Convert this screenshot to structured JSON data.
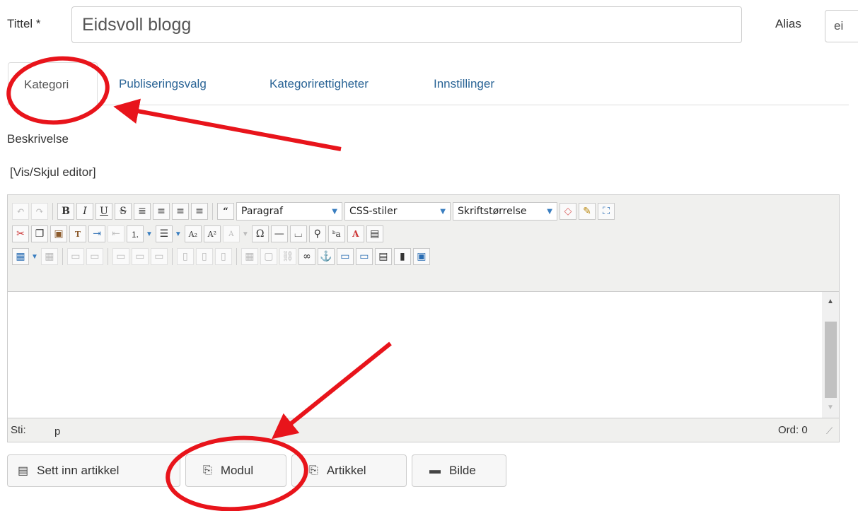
{
  "form": {
    "title_label": "Tittel *",
    "title_value": "Eidsvoll blogg",
    "alias_label": "Alias",
    "alias_value": "ei"
  },
  "tabs": [
    {
      "label": "Kategori",
      "active": true
    },
    {
      "label": "Publiseringsvalg"
    },
    {
      "label": "Kategorirettigheter"
    },
    {
      "label": "Innstillinger"
    }
  ],
  "description_label": "Beskrivelse",
  "toggle_editor": "[Vis/Skjul editor]",
  "editor": {
    "format_select": "Paragraf",
    "styles_select": "CSS-stiler",
    "fontsize_select": "Skriftstørrelse",
    "path_label": "Sti:",
    "path_value": "p",
    "word_count": "Ord: 0"
  },
  "buttons": {
    "insert_article": "Sett inn artikkel",
    "module": "Modul",
    "article": "Artikkel",
    "image": "Bilde"
  },
  "annotation_color": "#e8141b"
}
